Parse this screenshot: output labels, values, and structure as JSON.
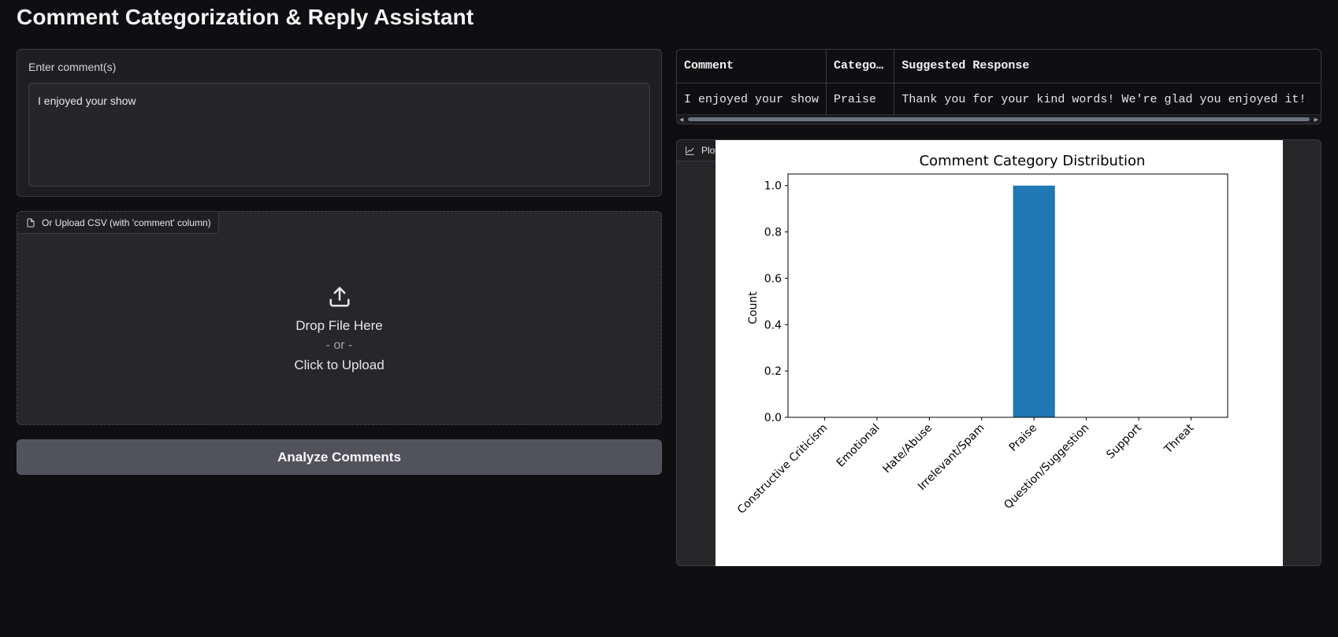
{
  "app": {
    "title": "Comment Categorization & Reply Assistant"
  },
  "comment_input": {
    "label": "Enter comment(s)",
    "value": "I enjoyed your show"
  },
  "upload": {
    "label": "Or Upload CSV (with 'comment' column)",
    "drop_text": "Drop File Here",
    "or_text": "- or -",
    "click_text": "Click to Upload"
  },
  "analyze_button": {
    "label": "Analyze Comments"
  },
  "results_table": {
    "headers": [
      "Comment",
      "Catego…",
      "Suggested Response"
    ],
    "rows": [
      [
        "I enjoyed your show",
        "Praise",
        "Thank you for your kind words! We're glad you enjoyed it!"
      ]
    ]
  },
  "plot_panel": {
    "label": "Plot"
  },
  "chart_data": {
    "type": "bar",
    "title": "Comment Category Distribution",
    "xlabel": "",
    "ylabel": "Count",
    "categories": [
      "Constructive Criticism",
      "Emotional",
      "Hate/Abuse",
      "Irrelevant/Spam",
      "Praise",
      "Question/Suggestion",
      "Support",
      "Threat"
    ],
    "values": [
      0,
      0,
      0,
      0,
      1,
      0,
      0,
      0
    ],
    "ylim": [
      0,
      1.05
    ],
    "yticks": [
      "0.0",
      "0.2",
      "0.4",
      "0.6",
      "0.8",
      "1.0"
    ],
    "bar_color": "#1f77b4",
    "grid": false
  }
}
